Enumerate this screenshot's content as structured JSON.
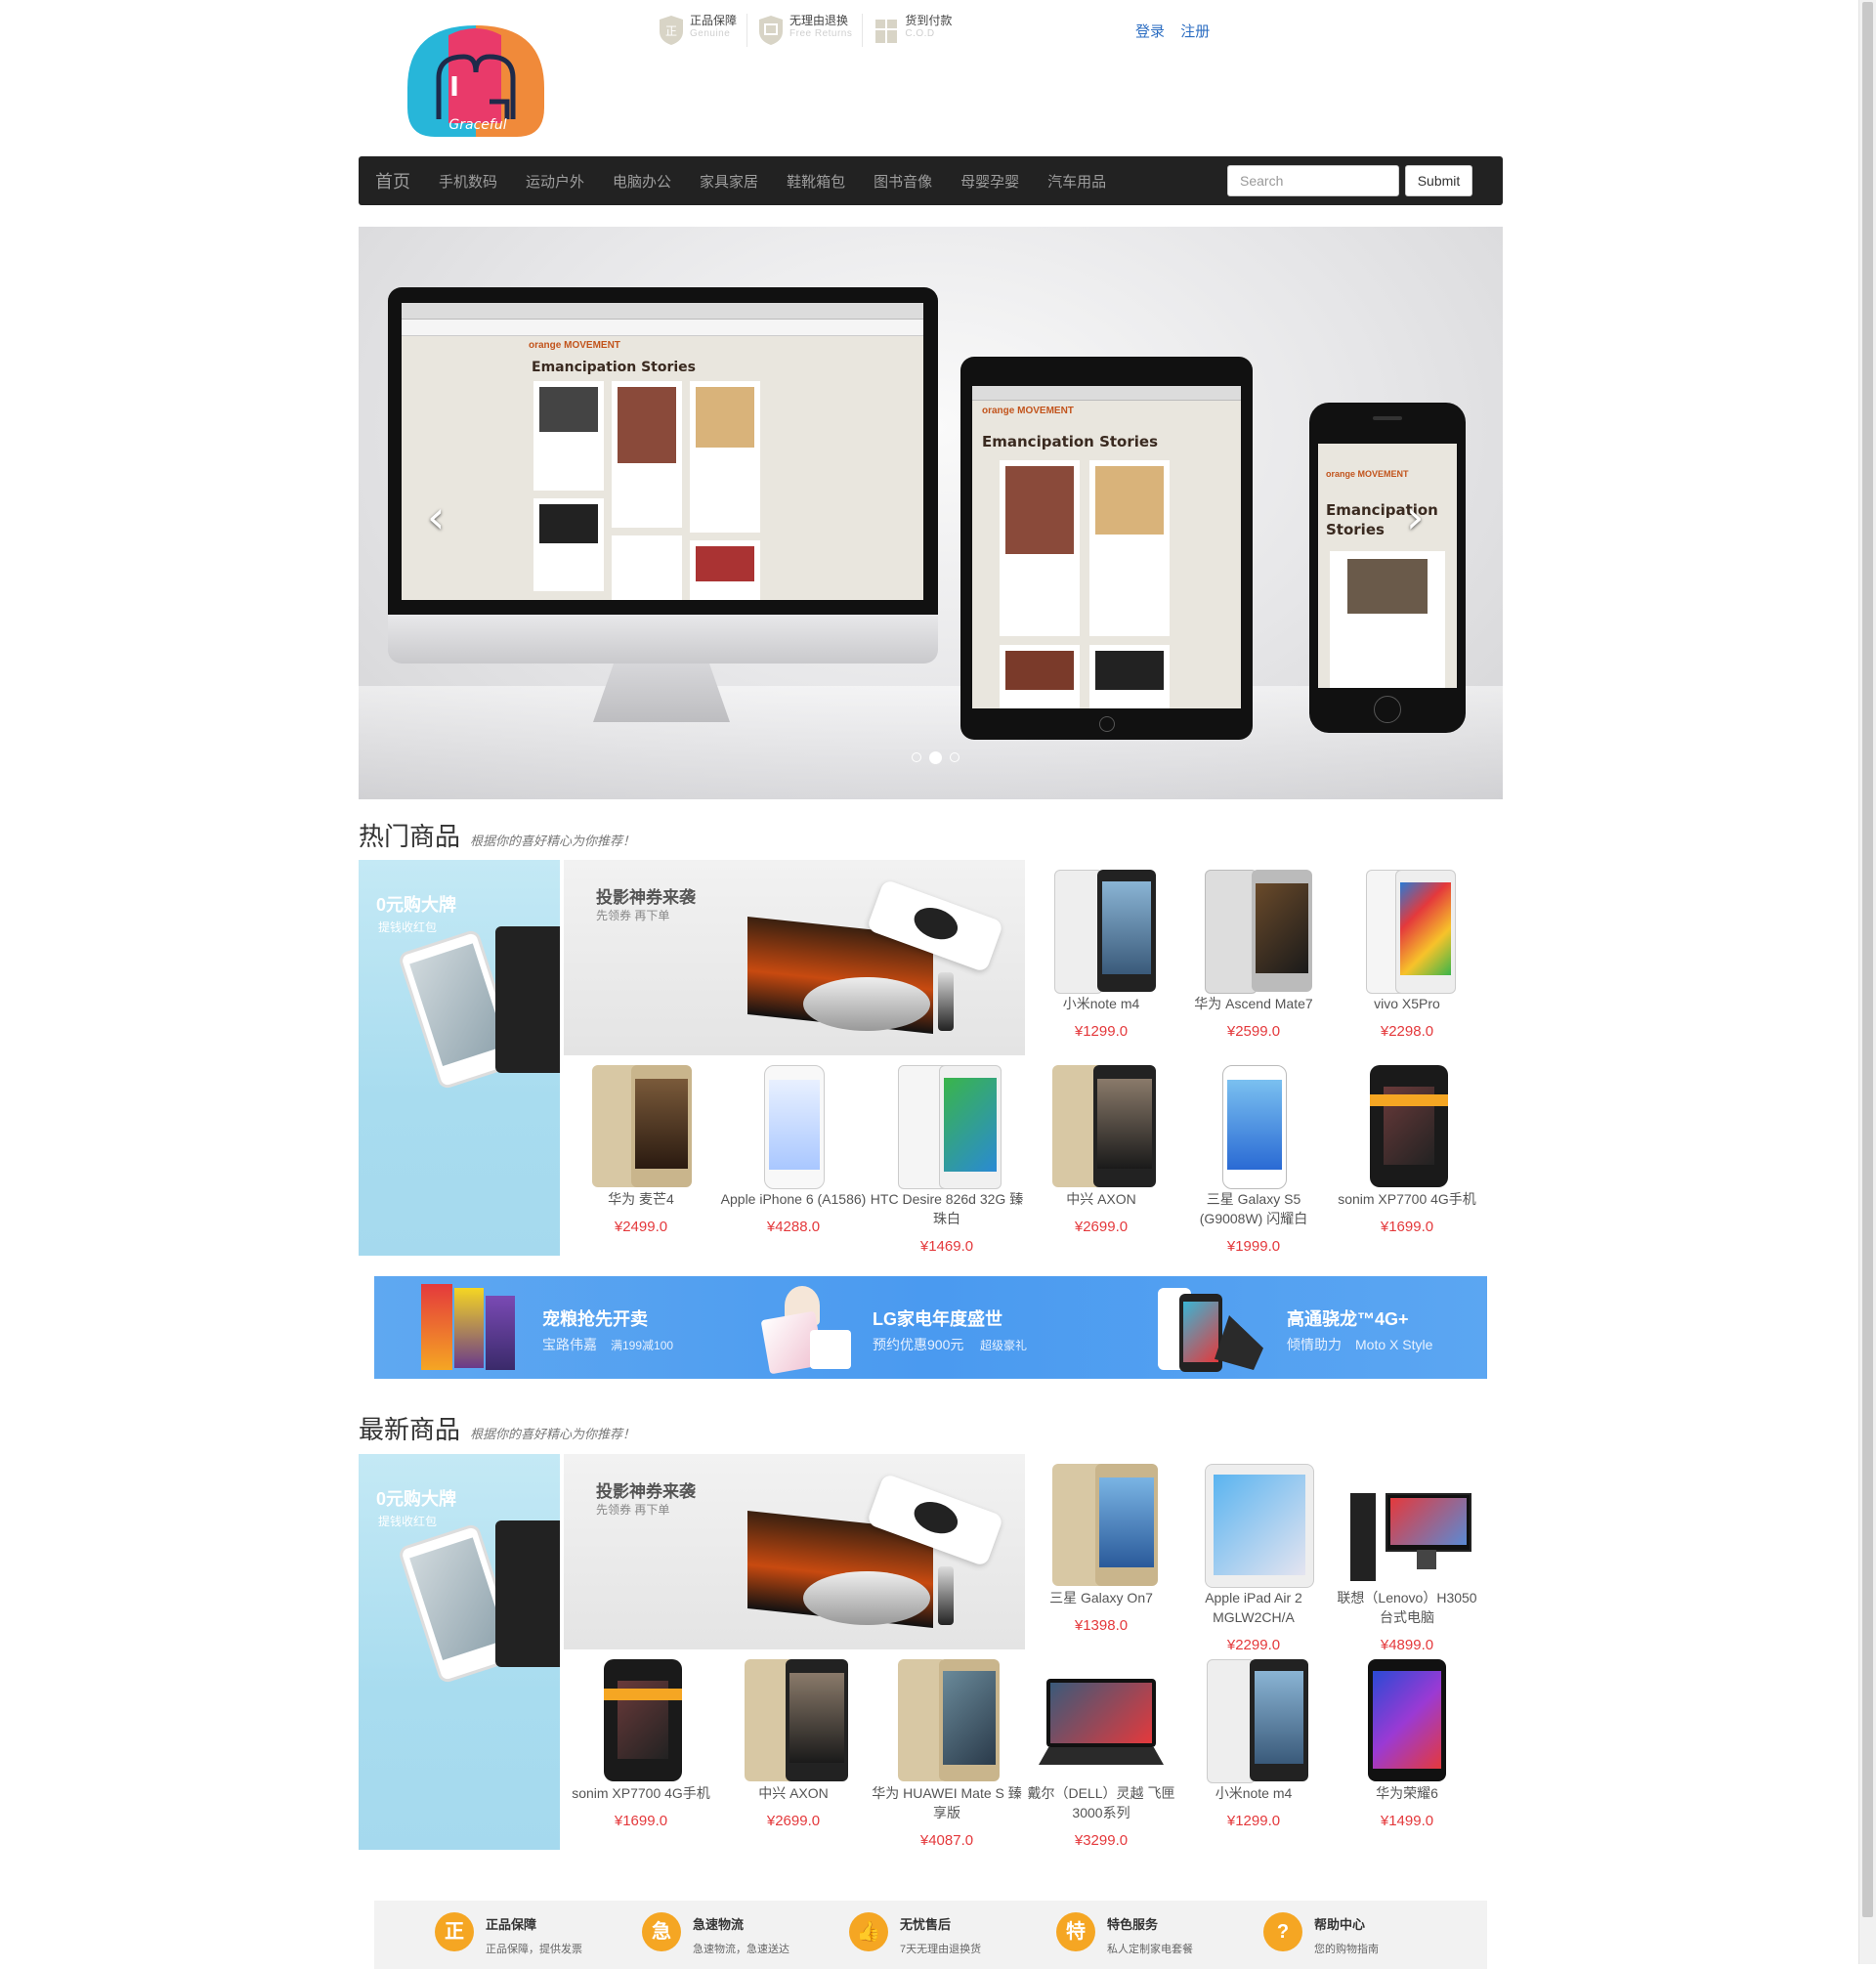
{
  "header": {
    "logo_text": "Graceful",
    "promises": [
      {
        "zh": "正品保障",
        "en": "Genuine",
        "icon": "genuine-shield-icon"
      },
      {
        "zh": "无理由退换",
        "en": "Free Returns",
        "icon": "returns-shield-icon"
      },
      {
        "zh": "货到付款",
        "en": "C.O.D",
        "icon": "cod-gift-icon"
      }
    ],
    "login": "登录",
    "register": "注册"
  },
  "nav": {
    "brand": "首页",
    "items": [
      "手机数码",
      "运动户外",
      "电脑办公",
      "家具家居",
      "鞋靴箱包",
      "图书音像",
      "母婴孕婴",
      "汽车用品"
    ],
    "search_placeholder": "Search",
    "submit": "Submit"
  },
  "carousel": {
    "site_title": "Emancipation Stories",
    "site_title_phone": "Emancipation Stories",
    "brand_text": "orange MOVEMENT",
    "slides": 3,
    "active_slide": 1
  },
  "hot": {
    "title": "热门商品",
    "subtitle": "根据你的喜好精心为你推荐！",
    "promo_left": {
      "title": "0元购大牌",
      "sub": "提钱收红包"
    },
    "promo_top": {
      "title": "投影神券来袭",
      "sub": "先领券 再下单"
    },
    "products": [
      {
        "name": "小米note m4",
        "price": "¥1299.0"
      },
      {
        "name": "华为 Ascend Mate7",
        "price": "¥2599.0"
      },
      {
        "name": "vivo X5Pro",
        "price": "¥2298.0"
      },
      {
        "name": "华为 麦芒4",
        "price": "¥2499.0"
      },
      {
        "name": "Apple iPhone 6 (A1586)",
        "price": "¥4288.0"
      },
      {
        "name": "HTC Desire 826d 32G 臻珠白",
        "price": "¥1469.0"
      },
      {
        "name": "中兴 AXON",
        "price": "¥2699.0"
      },
      {
        "name": "三星 Galaxy S5 (G9008W) 闪耀白",
        "price": "¥1999.0"
      },
      {
        "name": "sonim XP7700 4G手机",
        "price": "¥1699.0"
      }
    ]
  },
  "banner": [
    {
      "title": "宠粮抢先开卖",
      "sub": "宝路伟嘉",
      "sub2": "满199减100"
    },
    {
      "title": "LG家电年度盛世",
      "sub": "预约优惠900元",
      "sub2": "超级豪礼"
    },
    {
      "title": "高通骁龙™4G+",
      "sub": "倾情助力",
      "sub2": "Moto X Style"
    }
  ],
  "newest": {
    "title": "最新商品",
    "subtitle": "根据你的喜好精心为你推荐！",
    "promo_left": {
      "title": "0元购大牌",
      "sub": "提钱收红包"
    },
    "promo_top": {
      "title": "投影神券来袭",
      "sub": "先领券 再下单"
    },
    "products": [
      {
        "name": "三星 Galaxy On7",
        "price": "¥1398.0"
      },
      {
        "name": "Apple iPad Air 2 MGLW2CH/A",
        "price": "¥2299.0"
      },
      {
        "name": "联想（Lenovo）H3050 台式电脑",
        "price": "¥4899.0"
      },
      {
        "name": "sonim XP7700 4G手机",
        "price": "¥1699.0"
      },
      {
        "name": "中兴 AXON",
        "price": "¥2699.0"
      },
      {
        "name": "华为 HUAWEI Mate S 臻享版",
        "price": "¥4087.0"
      },
      {
        "name": "戴尔（DELL）灵越 飞匣3000系列",
        "price": "¥3299.0"
      },
      {
        "name": "小米note m4",
        "price": "¥1299.0"
      },
      {
        "name": "华为荣耀6",
        "price": "¥1499.0"
      }
    ]
  },
  "services": [
    {
      "title": "正品保障",
      "sub": "正品保障，提供发票",
      "glyph": "正"
    },
    {
      "title": "急速物流",
      "sub": "急速物流，急速送达",
      "glyph": "急"
    },
    {
      "title": "无忧售后",
      "sub": "7天无理由退换货",
      "glyph": "👍"
    },
    {
      "title": "特色服务",
      "sub": "私人定制家电套餐",
      "glyph": "特"
    },
    {
      "title": "帮助中心",
      "sub": "您的购物指南",
      "glyph": "?"
    }
  ],
  "colors": {
    "price": "#e4393c",
    "link": "#2d6ec2",
    "nav_bg": "#222222",
    "banner": "#4a9af0",
    "service_icon": "#f5a623"
  }
}
